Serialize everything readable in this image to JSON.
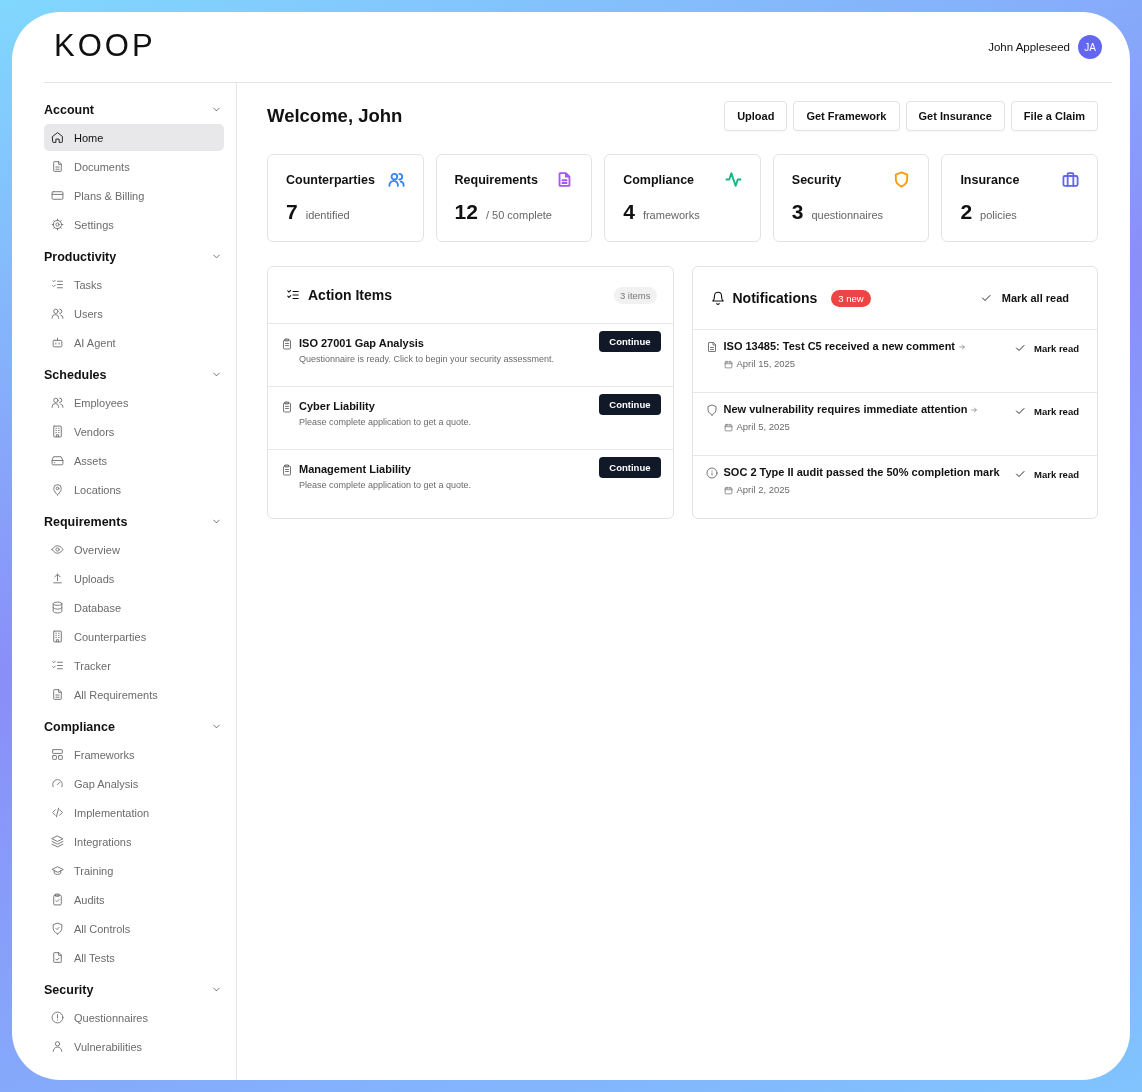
{
  "logo": "KOOP",
  "user": {
    "name": "John Appleseed",
    "initials": "JA"
  },
  "sidebar": {
    "sections": [
      {
        "title": "Account",
        "expanded": true,
        "items": [
          {
            "label": "Home",
            "selected": true
          },
          {
            "label": "Documents",
            "selected": false
          },
          {
            "label": "Plans & Billing",
            "selected": false
          },
          {
            "label": "Settings",
            "selected": false
          }
        ]
      },
      {
        "title": "Productivity",
        "expanded": true,
        "items": [
          {
            "label": "Tasks",
            "selected": false
          },
          {
            "label": "Users",
            "selected": false
          },
          {
            "label": "AI Agent",
            "selected": false
          }
        ]
      },
      {
        "title": "Schedules",
        "expanded": true,
        "items": [
          {
            "label": "Employees",
            "selected": false
          },
          {
            "label": "Vendors",
            "selected": false
          },
          {
            "label": "Assets",
            "selected": false
          },
          {
            "label": "Locations",
            "selected": false
          }
        ]
      },
      {
        "title": "Requirements",
        "expanded": true,
        "items": [
          {
            "label": "Overview",
            "selected": false
          },
          {
            "label": "Uploads",
            "selected": false
          },
          {
            "label": "Database",
            "selected": false
          },
          {
            "label": "Counterparties",
            "selected": false
          },
          {
            "label": "Tracker",
            "selected": false
          },
          {
            "label": "All Requirements",
            "selected": false
          }
        ]
      },
      {
        "title": "Compliance",
        "expanded": true,
        "items": [
          {
            "label": "Frameworks",
            "selected": false
          },
          {
            "label": "Gap Analysis",
            "selected": false
          },
          {
            "label": "Implementation",
            "selected": false
          },
          {
            "label": "Integrations",
            "selected": false
          },
          {
            "label": "Training",
            "selected": false
          },
          {
            "label": "Audits",
            "selected": false
          },
          {
            "label": "All Controls",
            "selected": false
          },
          {
            "label": "All Tests",
            "selected": false
          }
        ]
      },
      {
        "title": "Security",
        "expanded": true,
        "items": [
          {
            "label": "Questionnaires",
            "selected": false
          },
          {
            "label": "Vulnerabilities",
            "selected": false
          }
        ]
      }
    ]
  },
  "page_title": "Welcome, John",
  "actions": [
    "Upload",
    "Get Framework",
    "Get Insurance",
    "File a Claim"
  ],
  "stats": [
    {
      "title": "Counterparties",
      "value": "7",
      "unit": "identified",
      "color": "#3b82f6"
    },
    {
      "title": "Requirements",
      "value": "12",
      "unit": "/ 50 complete",
      "color": "#a855f7"
    },
    {
      "title": "Compliance",
      "value": "4",
      "unit": "frameworks",
      "color": "#10b981"
    },
    {
      "title": "Security",
      "value": "3",
      "unit": "questionnaires",
      "color": "#f59e0b"
    },
    {
      "title": "Insurance",
      "value": "2",
      "unit": "policies",
      "color": "#6366f1"
    }
  ],
  "action_items": {
    "title": "Action Items",
    "count": "3 items",
    "items": [
      {
        "title": "ISO 27001 Gap Analysis",
        "description": "Questionnaire is ready. Click to begin your security assessment.",
        "button": "Continue"
      },
      {
        "title": "Cyber Liability",
        "description": "Please complete application to get a quote.",
        "button": "Continue"
      },
      {
        "title": "Management Liability",
        "description": "Please complete application to get a quote.",
        "button": "Continue"
      }
    ]
  },
  "notifications": {
    "title": "Notifications",
    "badge": "3 new",
    "mark_all": "Mark all read",
    "items": [
      {
        "text": "ISO 13485: Test C5 received a new comment",
        "link": true,
        "date": "April 15, 2025",
        "action": "Mark read"
      },
      {
        "text": "New vulnerability requires immediate attention",
        "link": true,
        "date": "April 5, 2025",
        "action": "Mark read"
      },
      {
        "text": "SOC 2 Type II audit passed the 50% completion mark",
        "link": false,
        "date": "April 2, 2025",
        "action": "Mark read"
      }
    ]
  }
}
